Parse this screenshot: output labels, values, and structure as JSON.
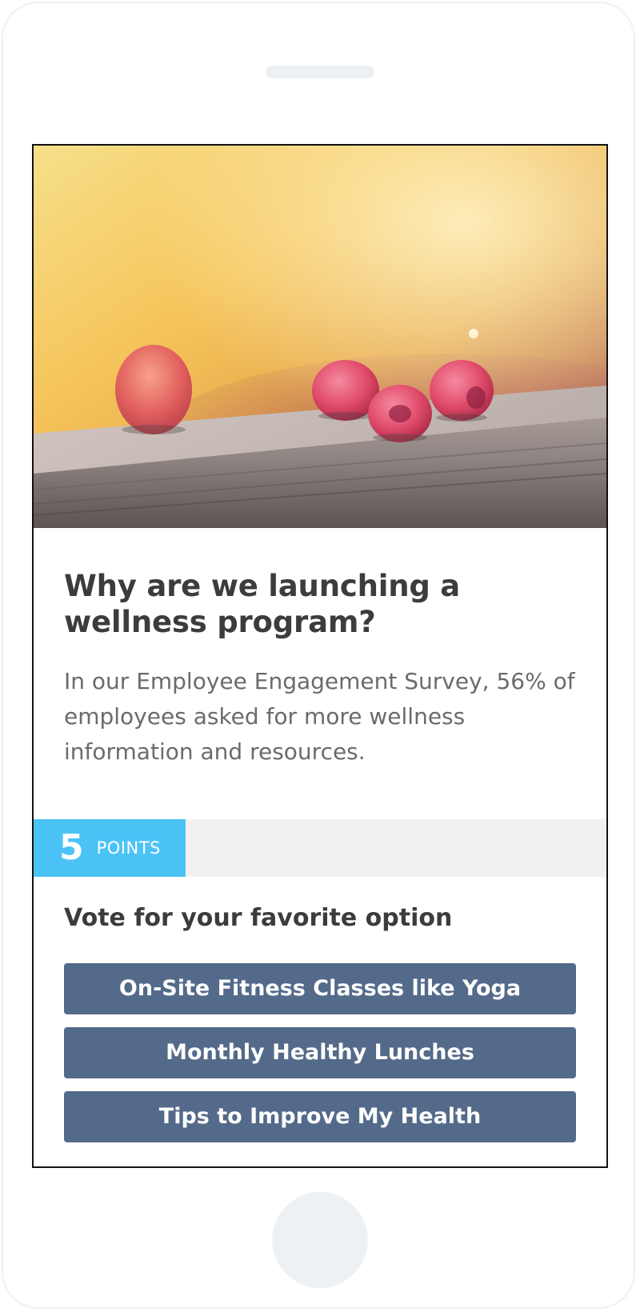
{
  "card": {
    "hero_image": "raspberries-on-wooden-rail-photo",
    "title": "Why are we launching a wellness program?",
    "body": "In our Employee Engagement Survey, 56% of employees asked for more wellness information and resources."
  },
  "points": {
    "value": "5",
    "label": "POINTS",
    "badge_color": "#4bc3f7"
  },
  "poll": {
    "prompt": "Vote for your favorite option",
    "options": [
      {
        "label": "On-Site Fitness Classes like Yoga"
      },
      {
        "label": "Monthly Healthy Lunches"
      },
      {
        "label": "Tips to Improve My Health"
      }
    ],
    "button_color": "#546a8a"
  }
}
